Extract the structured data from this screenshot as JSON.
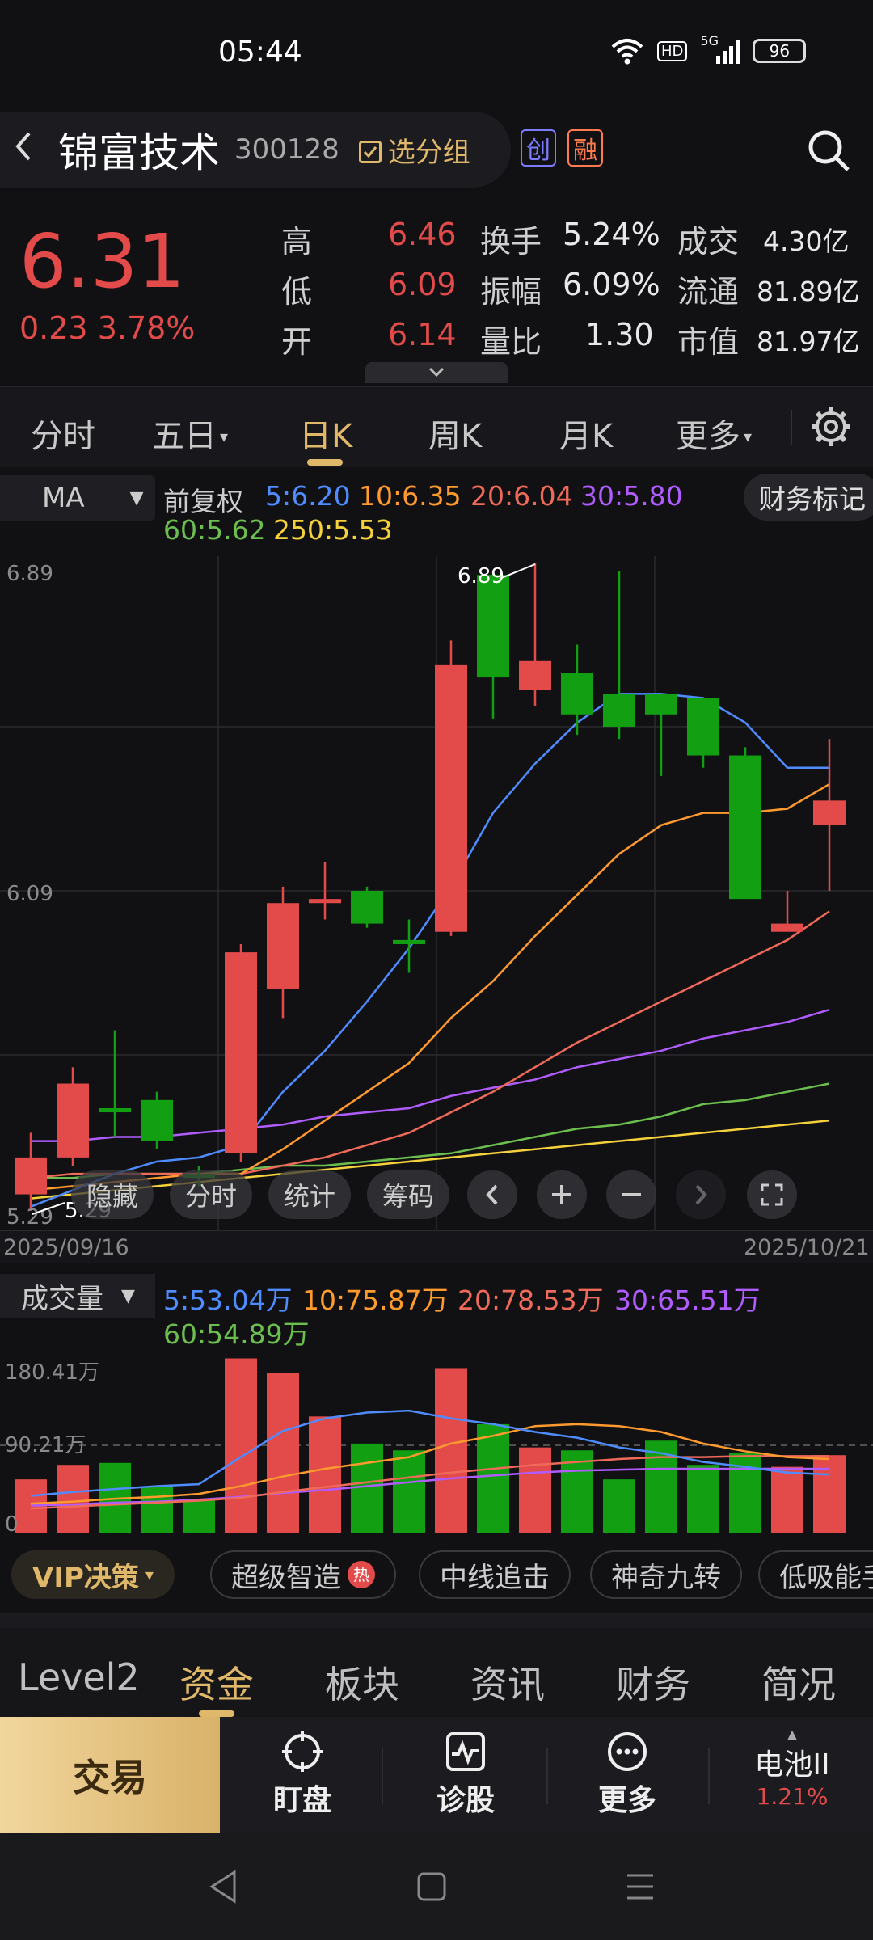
{
  "status_bar": {
    "time": "05:44",
    "hd": "HD",
    "network": "5G",
    "battery": "96"
  },
  "header": {
    "back_icon": "chevron-left-icon",
    "name": "锦富技术",
    "code": "300128",
    "group_label": "选分组",
    "badge_chuang": "创",
    "badge_rong": "融"
  },
  "quote": {
    "price": "6.31",
    "change": "0.23 3.78%",
    "rows": [
      {
        "l1": "高",
        "v1": "6.46",
        "l2": "换手",
        "v2": "5.24%",
        "l3": "成交",
        "v3": "4.30亿"
      },
      {
        "l1": "低",
        "v1": "6.09",
        "l2": "振幅",
        "v2": "6.09%",
        "l3": "流通",
        "v3": "81.89亿"
      },
      {
        "l1": "开",
        "v1": "6.14",
        "l2": "量比",
        "v2": "1.30",
        "l3": "市值",
        "v3": "81.97亿"
      }
    ]
  },
  "period_tabs": [
    "分时",
    "五日",
    "日K",
    "周K",
    "月K",
    "更多"
  ],
  "period_tab_arrows": [
    "▾",
    "▾"
  ],
  "ma_bar": {
    "selector": "MA",
    "adjust": "前复权",
    "ma5": "5:6.20",
    "ma10": "10:6.35",
    "ma20": "20:6.04",
    "ma30": "30:5.80",
    "ma60": "60:5.62",
    "ma250": "250:5.53",
    "finance_button": "财务标记"
  },
  "colors": {
    "up": "#e34b4b",
    "down": "#12a012",
    "ma5": "#4e8cff",
    "ma10": "#ff9a2e",
    "ma20": "#f06a5a",
    "ma30": "#b05cff",
    "ma60": "#6cbf4f",
    "ma250": "#f5d23c",
    "accent": "#e0b86a"
  },
  "kline_axis": {
    "top": "6.89",
    "mid": "6.09",
    "bottom": "5.29",
    "date_start": "2025/09/16",
    "date_end": "2025/10/21",
    "high_label": "6.89",
    "low_label": "5.29"
  },
  "chart_data": {
    "type": "candlestick",
    "ylim": [
      5.29,
      6.89
    ],
    "candles": [
      {
        "o": 5.35,
        "c": 5.44,
        "h": 5.5,
        "l": 5.31
      },
      {
        "o": 5.44,
        "c": 5.62,
        "h": 5.66,
        "l": 5.42
      },
      {
        "o": 5.56,
        "c": 5.55,
        "h": 5.75,
        "l": 5.49
      },
      {
        "o": 5.58,
        "c": 5.48,
        "h": 5.6,
        "l": 5.46
      },
      {
        "o": 5.4,
        "c": 5.39,
        "h": 5.42,
        "l": 5.37
      },
      {
        "o": 5.45,
        "c": 5.94,
        "h": 5.96,
        "l": 5.43
      },
      {
        "o": 5.85,
        "c": 6.06,
        "h": 6.1,
        "l": 5.78
      },
      {
        "o": 6.06,
        "c": 6.07,
        "h": 6.16,
        "l": 6.02
      },
      {
        "o": 6.09,
        "c": 6.01,
        "h": 6.1,
        "l": 6.0
      },
      {
        "o": 5.97,
        "c": 5.96,
        "h": 6.02,
        "l": 5.89
      },
      {
        "o": 5.99,
        "c": 6.64,
        "h": 6.7,
        "l": 5.98
      },
      {
        "o": 6.86,
        "c": 6.61,
        "h": 6.87,
        "l": 6.51
      },
      {
        "o": 6.58,
        "c": 6.65,
        "h": 6.89,
        "l": 6.54
      },
      {
        "o": 6.62,
        "c": 6.52,
        "h": 6.69,
        "l": 6.47
      },
      {
        "o": 6.57,
        "c": 6.49,
        "h": 6.87,
        "l": 6.46
      },
      {
        "o": 6.57,
        "c": 6.52,
        "h": 6.57,
        "l": 6.37
      },
      {
        "o": 6.56,
        "c": 6.42,
        "h": 6.56,
        "l": 6.39
      },
      {
        "o": 6.42,
        "c": 6.07,
        "h": 6.44,
        "l": 6.09
      },
      {
        "o": 5.99,
        "c": 6.01,
        "h": 6.09,
        "l": 6.0
      },
      {
        "o": 6.25,
        "c": 6.31,
        "h": 6.46,
        "l": 6.09
      }
    ],
    "ma5": [
      5.32,
      5.36,
      5.4,
      5.43,
      5.44,
      5.47,
      5.6,
      5.7,
      5.82,
      5.95,
      6.1,
      6.28,
      6.4,
      6.5,
      6.57,
      6.57,
      6.56,
      6.5,
      6.39,
      6.39
    ],
    "ma10": [
      5.36,
      5.37,
      5.38,
      5.39,
      5.4,
      5.4,
      5.46,
      5.53,
      5.6,
      5.67,
      5.78,
      5.87,
      5.98,
      6.08,
      6.18,
      6.25,
      6.28,
      6.28,
      6.29,
      6.35
    ],
    "ma20": [
      5.39,
      5.4,
      5.4,
      5.4,
      5.4,
      5.4,
      5.42,
      5.44,
      5.47,
      5.5,
      5.55,
      5.6,
      5.66,
      5.72,
      5.77,
      5.82,
      5.87,
      5.92,
      5.97,
      6.04
    ],
    "ma30": [
      5.48,
      5.48,
      5.49,
      5.49,
      5.5,
      5.51,
      5.52,
      5.54,
      5.55,
      5.56,
      5.59,
      5.61,
      5.63,
      5.66,
      5.68,
      5.7,
      5.73,
      5.75,
      5.77,
      5.8
    ],
    "ma60": [
      5.39,
      5.39,
      5.4,
      5.4,
      5.4,
      5.41,
      5.42,
      5.42,
      5.43,
      5.44,
      5.45,
      5.47,
      5.49,
      5.51,
      5.52,
      5.54,
      5.57,
      5.58,
      5.6,
      5.62
    ],
    "ma250": [
      5.34,
      5.35,
      5.36,
      5.37,
      5.38,
      5.39,
      5.4,
      5.41,
      5.42,
      5.43,
      5.44,
      5.45,
      5.46,
      5.47,
      5.48,
      5.49,
      5.5,
      5.51,
      5.52,
      5.53
    ],
    "volume": {
      "ylim": [
        0,
        180.41
      ],
      "values": [
        55,
        70,
        72,
        48,
        35,
        180,
        165,
        120,
        92,
        85,
        170,
        112,
        88,
        85,
        55,
        95,
        70,
        82,
        68,
        80
      ],
      "ma5": [
        38,
        42,
        45,
        48,
        50,
        78,
        105,
        118,
        124,
        126,
        118,
        112,
        104,
        98,
        88,
        82,
        73,
        68,
        62,
        60
      ],
      "ma10": [
        30,
        32,
        35,
        37,
        40,
        48,
        58,
        66,
        72,
        78,
        92,
        100,
        110,
        112,
        110,
        104,
        92,
        84,
        78,
        76
      ],
      "ma20": [
        25,
        27,
        29,
        31,
        33,
        36,
        42,
        47,
        52,
        57,
        62,
        66,
        70,
        73,
        76,
        78,
        78,
        79,
        79,
        79
      ],
      "ma30": [
        28,
        29,
        31,
        32,
        34,
        37,
        41,
        44,
        48,
        52,
        56,
        59,
        62,
        64,
        65,
        66,
        66,
        66,
        66,
        66
      ]
    }
  },
  "chart_controls": [
    "隐藏",
    "分时",
    "统计",
    "筹码"
  ],
  "volume_bar": {
    "selector": "成交量",
    "ma5": "5:53.04万",
    "ma10": "10:75.87万",
    "ma20": "20:78.53万",
    "ma30": "30:65.51万",
    "ma60": "60:54.89万",
    "axis_top": "180.41万",
    "axis_mid": "90.21万",
    "axis_zero": "0"
  },
  "chips": [
    "VIP决策",
    "超级智造",
    "中线追击",
    "神奇九转",
    "低吸能手"
  ],
  "chip_hot": "热",
  "chip_arrow": "▾",
  "bottom_tabs": [
    "Level2",
    "资金",
    "板块",
    "资讯",
    "财务",
    "简况"
  ],
  "actions": {
    "trade": "交易",
    "watch": "盯盘",
    "diagnose": "诊股",
    "more": "更多",
    "stock": "电池II",
    "stock_pct": "1.21%"
  }
}
